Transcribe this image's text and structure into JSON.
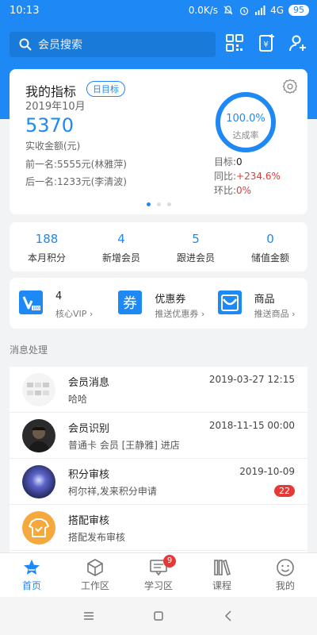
{
  "status_bar": {
    "time": "10:13",
    "network_speed": "0.0K/s",
    "signal": "4G",
    "battery": "95"
  },
  "search": {
    "placeholder": "会员搜索"
  },
  "header_icons": [
    "qr-code-icon",
    "scan-card-icon",
    "add-user-icon"
  ],
  "metrics": {
    "title": "我的指标",
    "badge": "日目标",
    "period": "2019年10月",
    "amount": "5370",
    "amount_label": "实收金额(元)",
    "prev_rank": "前一名:5555元(林雅萍)",
    "next_rank": "后一名:1233元(李清波)",
    "completion_rate": "100.0%",
    "completion_label": "达成率",
    "completion_value": 1.0,
    "target_label": "目标:",
    "target_value": "0",
    "yoy_label": "同比:",
    "yoy_value": "+234.6%",
    "mom_label": "环比:",
    "mom_value": "0%",
    "page_dots": 3,
    "active_dot": 0
  },
  "counts": [
    {
      "value": "188",
      "label": "本月积分"
    },
    {
      "value": "4",
      "label": "新增会员"
    },
    {
      "value": "5",
      "label": "跟进会员"
    },
    {
      "value": "0",
      "label": "储值金额"
    }
  ],
  "shortcuts": [
    {
      "icon": "vip-icon",
      "icon_text": "V",
      "title": "4",
      "subtitle": "核心VIP ›"
    },
    {
      "icon": "coupon-icon",
      "icon_text": "券",
      "title": "优惠券",
      "subtitle": "推送优惠券 ›"
    },
    {
      "icon": "shopping-bag-icon",
      "title": "商品",
      "subtitle": "推送商品 ›"
    }
  ],
  "section_label": "消息处理",
  "messages": [
    {
      "title": "会员消息",
      "text": "哈哈",
      "time": "2019-03-27 12:15",
      "badge": ""
    },
    {
      "title": "会员识别",
      "text": "普通卡 会员 [王静雅] 进店",
      "time": "2018-11-15 00:00",
      "badge": ""
    },
    {
      "title": "积分审核",
      "text": "柯尔祥,发来积分申请",
      "time": "2019-10-09",
      "badge": "22"
    },
    {
      "title": "搭配审核",
      "text": "搭配发布审核",
      "time": "",
      "badge": ""
    }
  ],
  "bottom_nav": [
    {
      "label": "首页",
      "icon": "home-star-icon",
      "active": true,
      "badge": ""
    },
    {
      "label": "工作区",
      "icon": "cube-icon",
      "active": false,
      "badge": ""
    },
    {
      "label": "学习区",
      "icon": "chat-board-icon",
      "active": false,
      "badge": "9"
    },
    {
      "label": "课程",
      "icon": "books-icon",
      "active": false,
      "badge": ""
    },
    {
      "label": "我的",
      "icon": "smile-face-icon",
      "active": false,
      "badge": ""
    }
  ],
  "colors": {
    "primary": "#1e88f5",
    "negative": "#e53935",
    "background": "#f2f3f5"
  }
}
